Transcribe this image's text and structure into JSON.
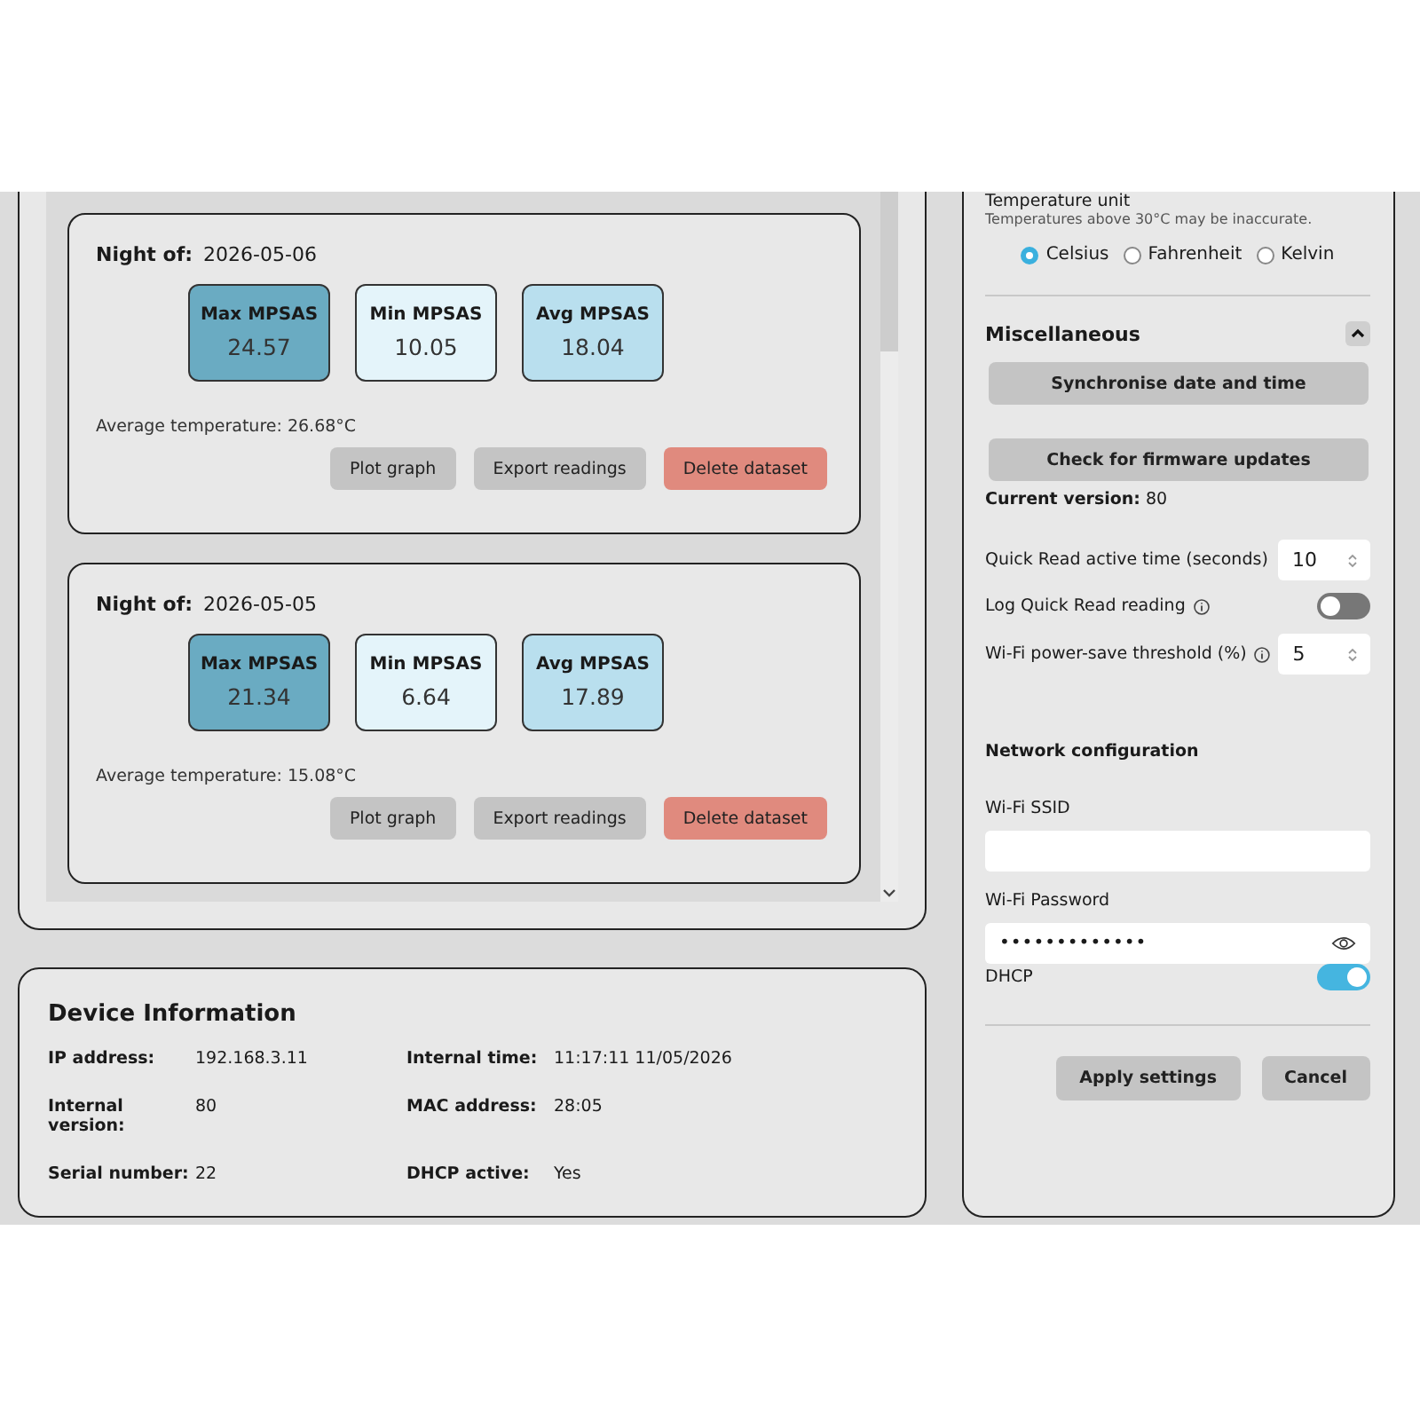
{
  "datasets": [
    {
      "night_label": "Night of:",
      "date": "2026-05-06",
      "stats": [
        {
          "kind": "max",
          "label": "Max MPSAS",
          "value": "24.57"
        },
        {
          "kind": "min",
          "label": "Min MPSAS",
          "value": "10.05"
        },
        {
          "kind": "avg",
          "label": "Avg MPSAS",
          "value": "18.04"
        }
      ],
      "avg_temperature": "Average temperature: 26.68°C",
      "buttons": [
        {
          "kind": "neutral",
          "label": "Plot graph"
        },
        {
          "kind": "neutral",
          "label": "Export readings"
        },
        {
          "kind": "danger",
          "label": "Delete dataset"
        }
      ]
    },
    {
      "night_label": "Night of:",
      "date": "2026-05-05",
      "stats": [
        {
          "kind": "max",
          "label": "Max MPSAS",
          "value": "21.34"
        },
        {
          "kind": "min",
          "label": "Min MPSAS",
          "value": "6.64"
        },
        {
          "kind": "avg",
          "label": "Avg MPSAS",
          "value": "17.89"
        }
      ],
      "avg_temperature": "Average temperature: 15.08°C",
      "buttons": [
        {
          "kind": "neutral",
          "label": "Plot graph"
        },
        {
          "kind": "neutral",
          "label": "Export readings"
        },
        {
          "kind": "danger",
          "label": "Delete dataset"
        }
      ]
    }
  ],
  "device_info": {
    "title": "Device Information",
    "fields": [
      {
        "label": "IP address:",
        "value": "192.168.3.11"
      },
      {
        "label": "Internal time:",
        "value": "11:17:11 11/05/2026"
      },
      {
        "label": "Internal version:",
        "value": "80"
      },
      {
        "label": "MAC address:",
        "value": "28:05"
      },
      {
        "label": "Serial number:",
        "value": "22"
      },
      {
        "label": "DHCP active:",
        "value": "Yes"
      }
    ]
  },
  "settings": {
    "temperature_unit": {
      "label": "Temperature unit",
      "hint": "Temperatures above 30°C may be inaccurate.",
      "options": [
        {
          "label": "Celsius",
          "selected": true
        },
        {
          "label": "Fahrenheit",
          "selected": false
        },
        {
          "label": "Kelvin",
          "selected": false
        }
      ]
    },
    "misc": {
      "title": "Miscellaneous",
      "expanded": true,
      "buttons": [
        "Synchronise date and time",
        "Check for firmware updates"
      ],
      "current_version_label": "Current version:",
      "current_version": "80",
      "quick_read_time": {
        "label": "Quick Read active time (seconds)",
        "value": "10"
      },
      "log_quick_read": {
        "label": "Log Quick Read reading",
        "on": false
      },
      "wifi_threshold": {
        "label": "Wi-Fi power-save threshold (%)",
        "value": "5"
      }
    },
    "network": {
      "title": "Network configuration",
      "ssid_label": "Wi-Fi SSID",
      "password_label": "Wi-Fi Password",
      "password": "•••••••••••••",
      "dhcp": {
        "label": "DHCP",
        "on": true
      }
    },
    "actions": [
      "Apply settings",
      "Cancel"
    ]
  }
}
